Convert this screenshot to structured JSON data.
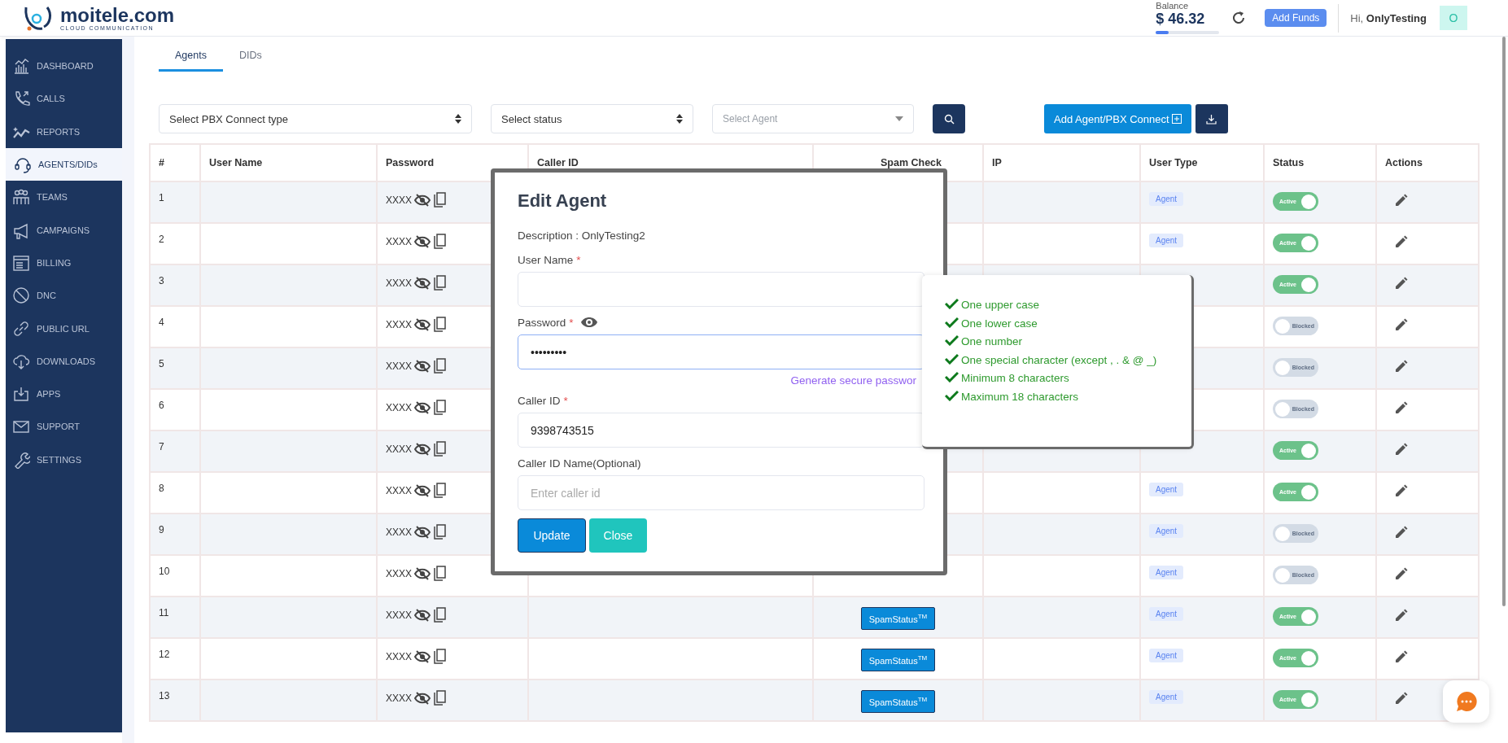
{
  "header": {
    "logo": {
      "name": "moitele.com",
      "tagline": "CLOUD COMMUNICATION"
    },
    "balance": {
      "label": "Balance",
      "amount": "$ 46.32",
      "level": 0.2
    },
    "add_funds": "Add Funds",
    "greeting": "Hi, **OnlyTesting**",
    "avatar": "O"
  },
  "sidebar": {
    "items": [
      {
        "label": "DASHBOARD",
        "selected": false
      },
      {
        "label": "CALLS",
        "selected": false
      },
      {
        "label": "REPORTS",
        "selected": false
      },
      {
        "label": "AGENTS/DIDs",
        "selected": true
      },
      {
        "label": "TEAMS",
        "selected": false
      },
      {
        "label": "CAMPAIGNS",
        "selected": false
      },
      {
        "label": "BILLING",
        "selected": false
      },
      {
        "label": "DNC",
        "selected": false
      },
      {
        "label": "PUBLIC URL",
        "selected": false
      },
      {
        "label": "DOWNLOADS",
        "selected": false
      },
      {
        "label": "APPS",
        "selected": false
      },
      {
        "label": "SUPPORT",
        "selected": false
      },
      {
        "label": "SETTINGS",
        "selected": false
      }
    ]
  },
  "tabs": [
    {
      "label": "Agents",
      "selected": true
    },
    {
      "label": "DIDs",
      "selected": false
    }
  ],
  "filters": [
    {
      "kind": "select",
      "label": "Select PBX Connect type"
    },
    {
      "kind": "select",
      "label": "Select status"
    },
    {
      "kind": "dropdown",
      "placeholder": "Select Agent"
    }
  ],
  "add_button": "Add Agent/PBX Connect",
  "table": {
    "columns": [
      "#",
      "User Name",
      "Password",
      "Caller ID",
      "Spam Check",
      "IP",
      "User Type",
      "Status",
      "Actions"
    ],
    "rows": [
      {
        "number": "1",
        "password": "XXXX",
        "user_type": "Agent",
        "status": {
          "active": true,
          "label": "Active"
        }
      },
      {
        "number": "2",
        "password": "XXXX",
        "user_type": "Agent",
        "status": {
          "active": true,
          "label": "Active"
        }
      },
      {
        "number": "3",
        "password": "XXXX",
        "status": {
          "active": true,
          "label": "Active"
        }
      },
      {
        "number": "4",
        "password": "XXXX",
        "status": {
          "active": false,
          "label": "Blocked"
        }
      },
      {
        "number": "5",
        "password": "XXXX",
        "status": {
          "active": false,
          "label": "Blocked"
        }
      },
      {
        "number": "6",
        "password": "XXXX",
        "status": {
          "active": false,
          "label": "Blocked"
        }
      },
      {
        "number": "7",
        "password": "XXXX",
        "status": {
          "active": true,
          "label": "Active"
        }
      },
      {
        "number": "8",
        "password": "XXXX",
        "user_type": "Agent",
        "status": {
          "active": true,
          "label": "Active"
        }
      },
      {
        "number": "9",
        "password": "XXXX",
        "user_type": "Agent",
        "status": {
          "active": false,
          "label": "Blocked"
        }
      },
      {
        "number": "10",
        "password": "XXXX",
        "user_type": "Agent",
        "status": {
          "active": false,
          "label": "Blocked"
        }
      },
      {
        "number": "11",
        "password": "XXXX",
        "spam_check": "SpamStatus$^{TM}$",
        "user_type": "Agent",
        "status": {
          "active": true,
          "label": "Active"
        }
      },
      {
        "number": "12",
        "password": "XXXX",
        "spam_check": "SpamStatus$^{TM}$",
        "user_type": "Agent",
        "status": {
          "active": true,
          "label": "Active"
        }
      },
      {
        "number": "13",
        "password": "XXXX",
        "spam_check": "SpamStatus$^{TM}$",
        "user_type": "Agent",
        "status": {
          "active": true,
          "label": "Active"
        }
      }
    ]
  },
  "modal": {
    "title": "Edit Agent",
    "description": "Description : OnlyTesting2",
    "fields": [
      {
        "label": "User Name",
        "required_mark": "*"
      },
      {
        "label": "Password",
        "required_mark": "*",
        "kind": "password",
        "value": "•••••••••",
        "link": "Generate secure passwor"
      },
      {
        "label": "Caller ID",
        "required_mark": "*",
        "value": "9398743515"
      },
      {
        "label": "Caller ID Name(Optional)",
        "placeholder": "Enter caller id"
      }
    ],
    "buttons": [
      {
        "label": "Update",
        "kind": "primary"
      },
      {
        "label": "Close",
        "kind": "secondary"
      }
    ]
  },
  "password_rules": [
    {
      "text": "One upper case",
      "met": true
    },
    {
      "text": "One lower case",
      "met": true
    },
    {
      "text": "One number",
      "met": true
    },
    {
      "text": "One special character (except , . & @ _)",
      "met": true
    },
    {
      "text": "Minimum 8 characters",
      "met": true
    },
    {
      "text": "Maximum 18 characters",
      "met": true
    }
  ]
}
